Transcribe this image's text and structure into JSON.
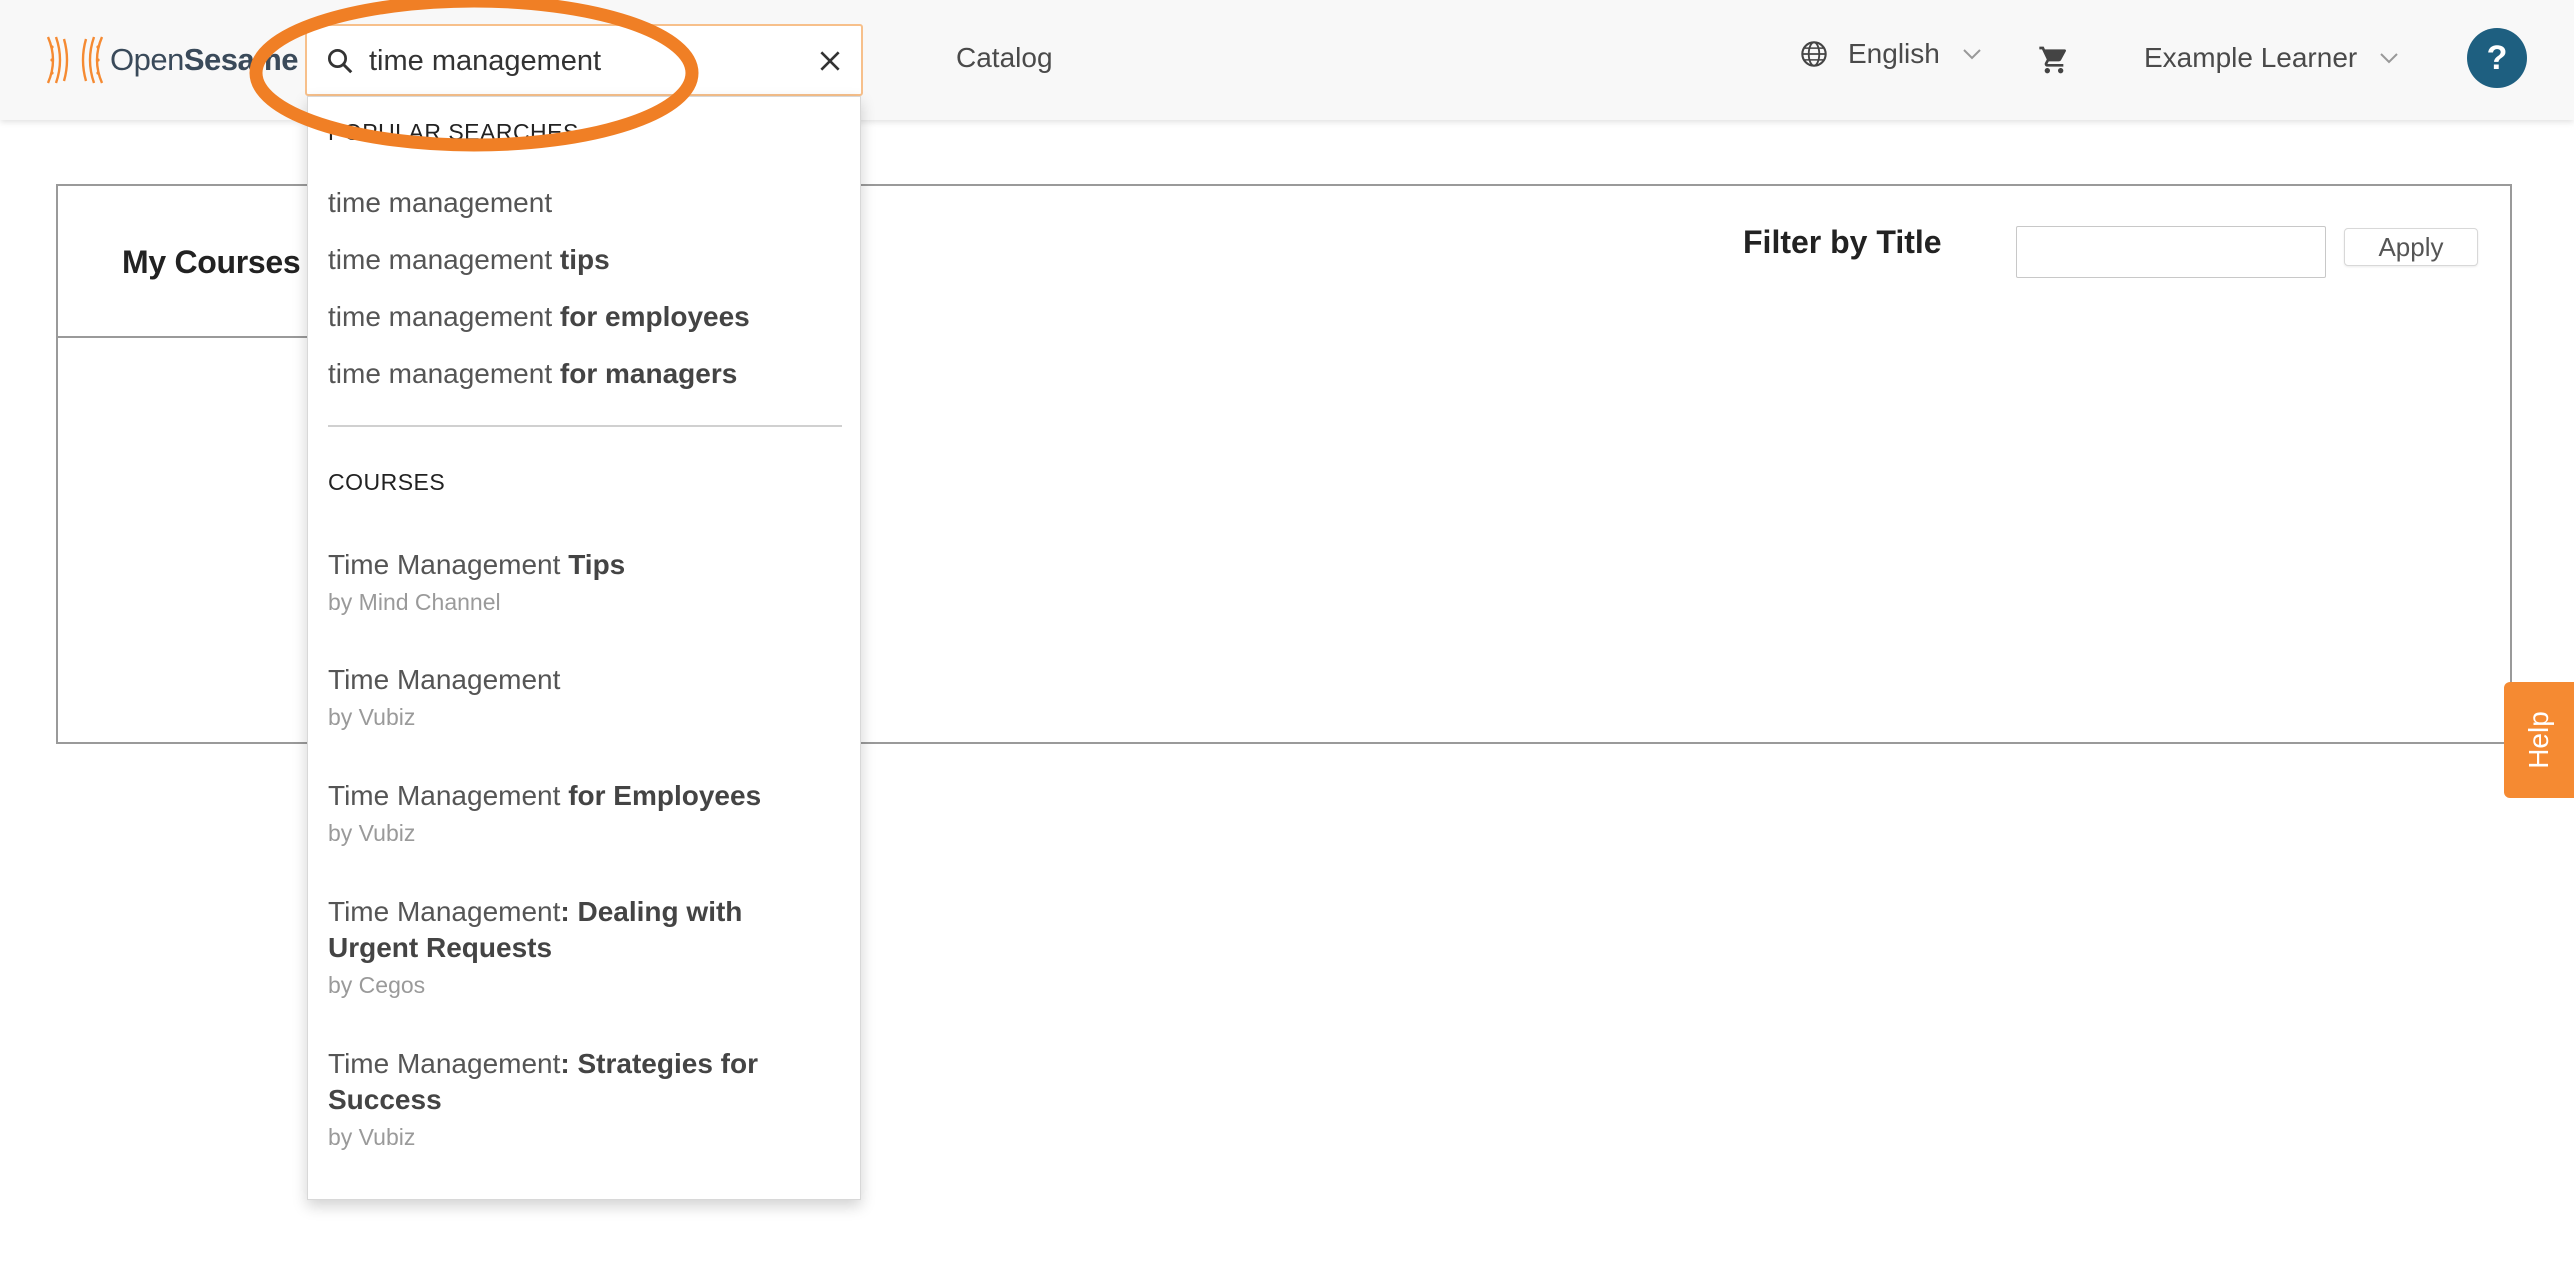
{
  "header": {
    "logo": {
      "text_plain": "Open",
      "text_bold": "Sesame",
      "icon": "opensesame-logo-icon"
    },
    "search": {
      "value": "time management",
      "placeholder": ""
    },
    "nav_catalog": "Catalog",
    "language": "English",
    "user_name": "Example Learner",
    "help_symbol": "?"
  },
  "dropdown": {
    "popular_heading": "POPULAR SEARCHES",
    "popular_searches": [
      {
        "base": "time management",
        "suffix": ""
      },
      {
        "base": "time management ",
        "suffix": "tips"
      },
      {
        "base": "time management ",
        "suffix": "for employees"
      },
      {
        "base": "time management ",
        "suffix": "for managers"
      }
    ],
    "courses_heading": "COURSES",
    "courses": [
      {
        "base": "Time Management ",
        "suffix": "Tips",
        "provider": "by Mind Channel"
      },
      {
        "base": "Time Management",
        "suffix": "",
        "provider": "by Vubiz"
      },
      {
        "base": "Time Management ",
        "suffix": "for Employees",
        "provider": "by Vubiz"
      },
      {
        "base": "Time Management",
        "suffix": ": Dealing with Urgent Requests",
        "provider": "by Cegos"
      },
      {
        "base": "Time Management",
        "suffix": ": Strategies for Success",
        "provider": "by Vubiz"
      }
    ]
  },
  "main": {
    "my_courses": "My Courses",
    "filter_label": "Filter by Title",
    "filter_value": "",
    "apply_label": "Apply"
  },
  "help_tab": "Help",
  "colors": {
    "accent_orange": "#f58a32",
    "help_blue": "#1e5f80",
    "header_bg": "#f8f8f8"
  }
}
